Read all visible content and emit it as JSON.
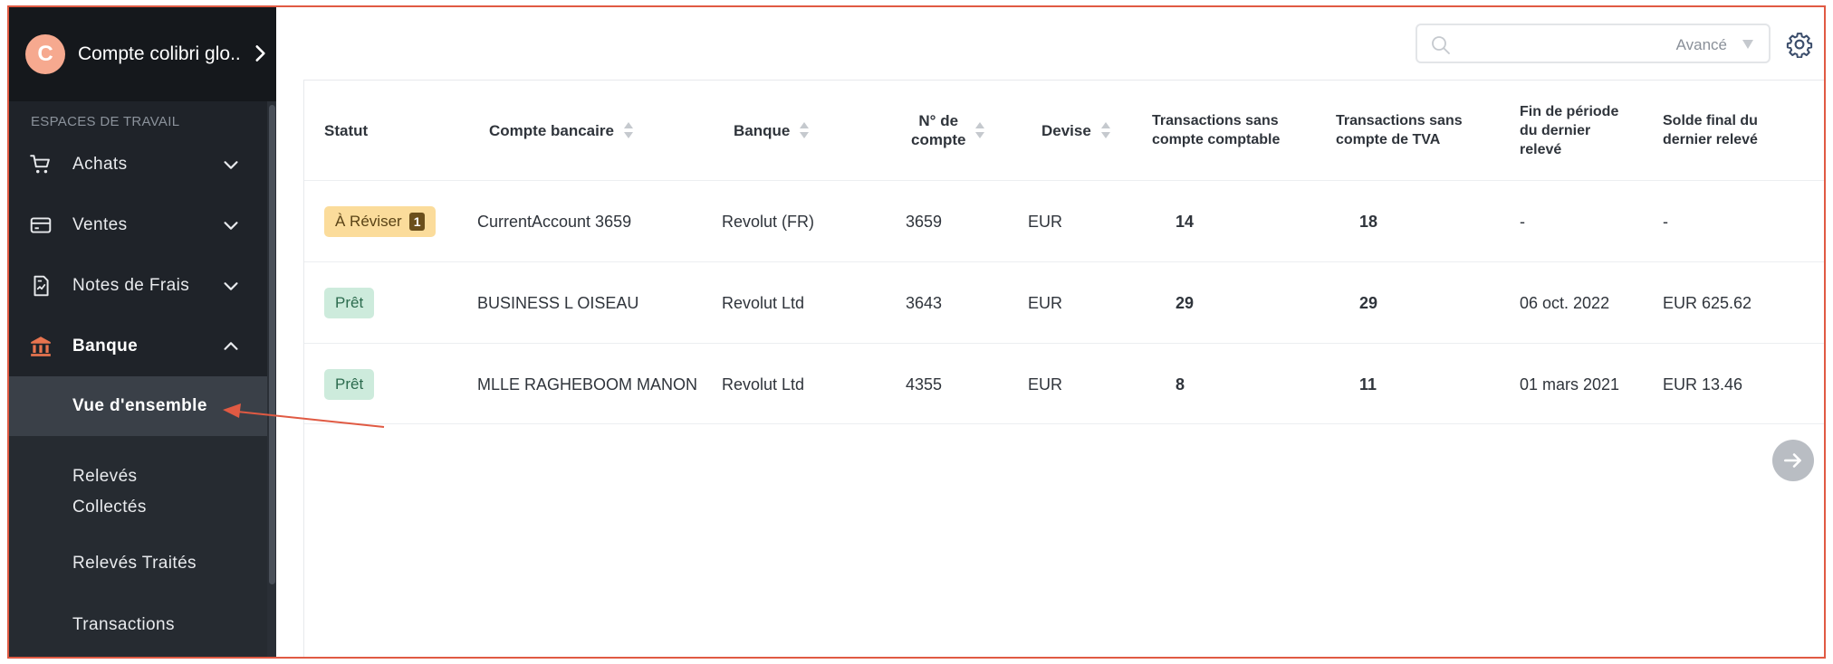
{
  "account": {
    "initial": "C",
    "name": "Compte colibri glo..."
  },
  "sidebar": {
    "section_label": "ESPACES DE TRAVAIL",
    "items": [
      {
        "label": "Achats",
        "icon": "cart-icon"
      },
      {
        "label": "Ventes",
        "icon": "card-icon"
      },
      {
        "label": "Notes de Frais",
        "icon": "receipt-icon"
      },
      {
        "label": "Banque",
        "icon": "bank-icon"
      }
    ],
    "sub_items": [
      {
        "label": "Vue d'ensemble"
      },
      {
        "label_line1": "Relevés",
        "label_line2": "Collectés"
      },
      {
        "label": "Relevés Traités"
      },
      {
        "label": "Transactions"
      }
    ]
  },
  "toolbar": {
    "advanced_label": "Avancé"
  },
  "table": {
    "headers": {
      "status": "Statut",
      "account": "Compte bancaire",
      "bank": "Banque",
      "number_l1": "N° de",
      "number_l2": "compte",
      "currency": "Devise",
      "tx_acc_l1": "Transactions sans",
      "tx_acc_l2": "compte comptable",
      "tx_vat_l1": "Transactions sans",
      "tx_vat_l2": "compte de TVA",
      "end_l1": "Fin de période",
      "end_l2": "du dernier",
      "end_l3": "relevé",
      "bal_l1": "Solde final du",
      "bal_l2": "dernier relevé"
    },
    "rows": [
      {
        "status": "À Réviser",
        "status_count": "1",
        "account": "CurrentAccount 3659",
        "bank": "Revolut (FR)",
        "number": "3659",
        "currency": "EUR",
        "tx_acc": "14",
        "tx_vat": "18",
        "end": "-",
        "balance": "-"
      },
      {
        "status": "Prêt",
        "account": "BUSINESS L OISEAU",
        "bank": "Revolut Ltd",
        "number": "3643",
        "currency": "EUR",
        "tx_acc": "29",
        "tx_vat": "29",
        "end": "06 oct. 2022",
        "balance": "EUR 625.62"
      },
      {
        "status": "Prêt",
        "account": "MLLE RAGHEBOOM MANON",
        "bank": "Revolut Ltd",
        "number": "4355",
        "currency": "EUR",
        "tx_acc": "8",
        "tx_vat": "11",
        "end": "01 mars 2021",
        "balance": "EUR 13.46"
      }
    ]
  },
  "colors": {
    "sidebar_bg": "#1f2329",
    "accent": "#e8744f",
    "annotation": "#e05a43",
    "review_badge": "#fbdc9b",
    "ready_badge": "#cdebdc"
  }
}
